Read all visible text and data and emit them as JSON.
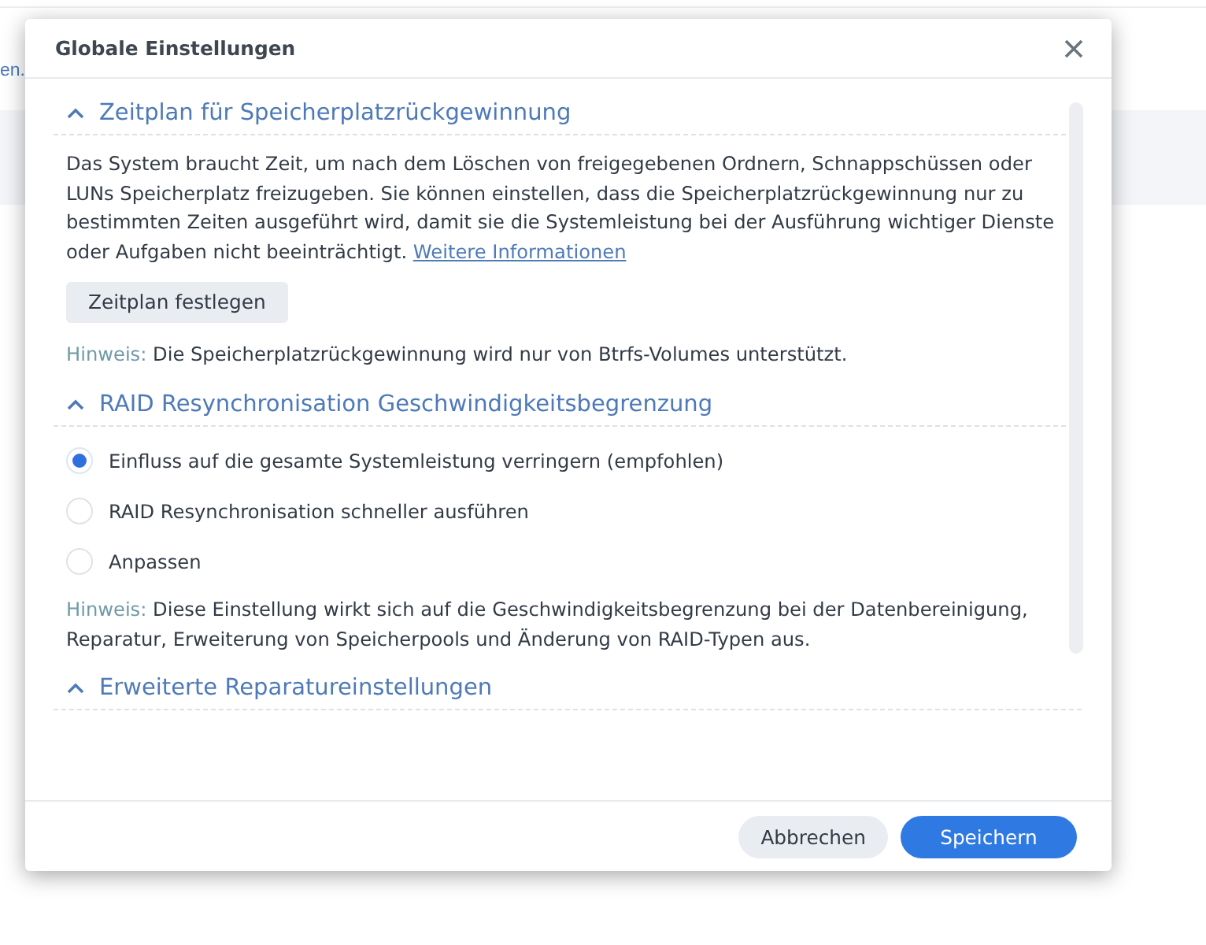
{
  "background": {
    "link_fragment": "en."
  },
  "dialog": {
    "title": "Globale Einstellungen"
  },
  "sections": [
    {
      "kind": "text",
      "title": "Zeitplan für Speicherplatzrückgewinnung",
      "expanded": true,
      "description": "Das System braucht Zeit, um nach dem Löschen von freigegebenen Ordnern, Schnappschüssen oder LUNs Speicherplatz freizugeben. Sie können einstellen, dass die Speicherplatzrückgewinnung nur zu bestimmten Zeiten ausgeführt wird, damit sie die Systemleistung bei der Ausführung wichtiger Dienste oder Aufgaben nicht beeinträchtigt.",
      "link": "Weitere Informationen",
      "button": "Zeitplan festlegen",
      "note_label": "Hinweis:",
      "note": "Die Speicherplatzrückgewinnung wird nur von Btrfs-Volumes unterstützt."
    },
    {
      "kind": "radios",
      "title": "RAID Resynchronisation Geschwindigkeitsbegrenzung",
      "expanded": true,
      "options": [
        {
          "label": "Einfluss auf die gesamte Systemleistung verringern (empfohlen)",
          "selected": true
        },
        {
          "label": "RAID Resynchronisation schneller ausführen",
          "selected": false
        },
        {
          "label": "Anpassen",
          "selected": false
        }
      ],
      "note_label": "Hinweis:",
      "note": "Diese Einstellung wirkt sich auf die Geschwindigkeitsbegrenzung bei der Datenbereinigung, Reparatur, Erweiterung von Speicherpools und Änderung von RAID-Typen aus."
    },
    {
      "kind": "heading",
      "title": "Erweiterte Reparatureinstellungen",
      "expanded": true
    }
  ],
  "buttons": [
    {
      "label": "Abbrechen",
      "kind": "secondary"
    },
    {
      "label": "Speichern",
      "kind": "primary"
    }
  ]
}
